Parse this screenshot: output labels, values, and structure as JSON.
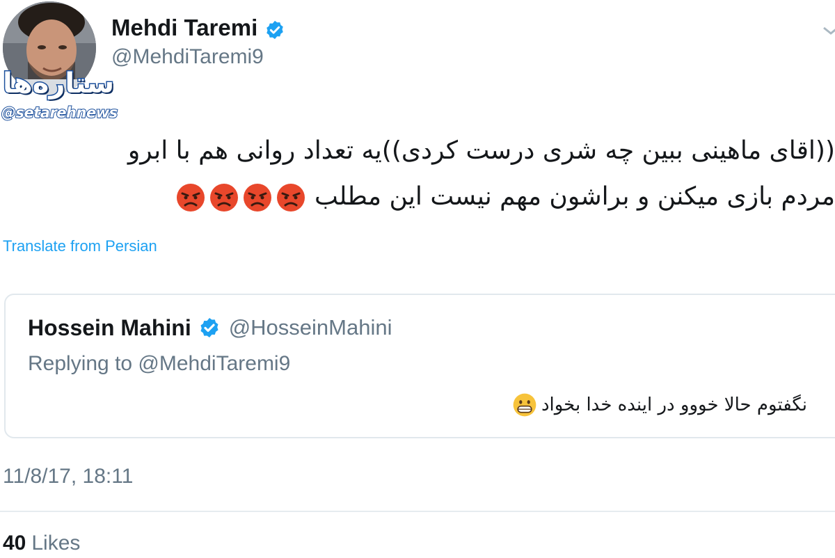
{
  "tweet": {
    "author": {
      "name": "Mehdi Taremi",
      "handle": "@MehdiTaremi9",
      "verified": true
    },
    "text_lines": [
      "((اقای ماهینی ببین چه شری درست کردی))یه تعداد روانی هم با ابرو",
      "مردم بازی میکنن و براشون مهم نیست این مطلب"
    ],
    "text_emoji": [
      "pouting-face",
      "pouting-face",
      "pouting-face",
      "pouting-face"
    ],
    "translate_label": "Translate from Persian",
    "timestamp": "11/8/17, 18:11",
    "likes": {
      "count": "40",
      "label": "Likes"
    }
  },
  "quoted_tweet": {
    "author": {
      "name": "Hossein Mahini",
      "handle": "@HosseinMahini",
      "verified": true
    },
    "replying_to": "Replying to @MehdiTaremi9",
    "text": "نگفتوم حالا خووو در اینده خدا بخواد",
    "text_emoji": [
      "grinning-face"
    ]
  },
  "watermark": {
    "logo_text": "ستاره‌ها",
    "handle": "@setarehnews"
  },
  "colors": {
    "link": "#1da1f2",
    "secondary_text": "#657786",
    "primary_text": "#14171a",
    "border": "#e1e8ed",
    "verified_badge": "#1da1f2",
    "watermark_stroke": "#1b4f9c"
  }
}
